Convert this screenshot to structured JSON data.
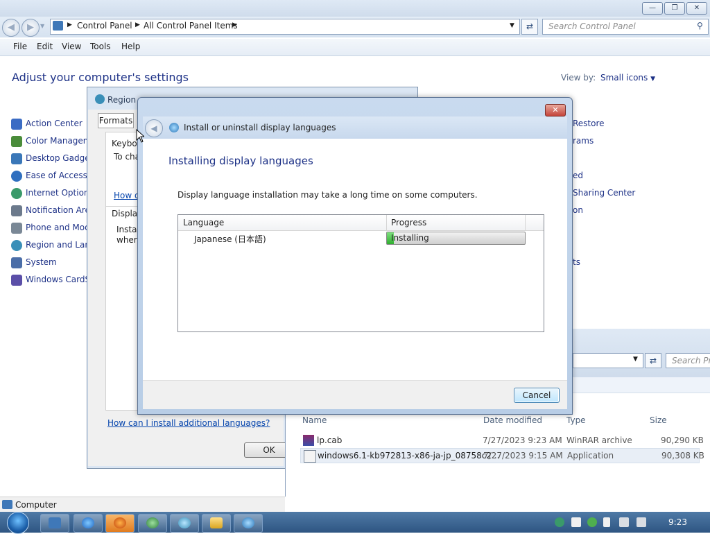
{
  "control_panel": {
    "breadcrumb": [
      "Control Panel",
      "All Control Panel Items"
    ],
    "search_placeholder": "Search Control Panel",
    "menu": [
      "File",
      "Edit",
      "View",
      "Tools",
      "Help"
    ],
    "page_title": "Adjust your computer's settings",
    "view_by_label": "View by:",
    "view_by_value": "Small icons",
    "left_items": [
      "Action Center",
      "Color Manageme",
      "Desktop Gadgets",
      "Ease of Access C",
      "Internet Options",
      "Notification Area",
      "Phone and Mode",
      "Region and Lang",
      "System",
      "Windows CardSp"
    ],
    "right_items": [
      "Restore",
      "rams",
      "ed",
      "Sharing Center",
      "on",
      "ts"
    ],
    "status_text": "Computer"
  },
  "region_dialog": {
    "title": "Region a",
    "tab_formats": "Formats",
    "keyboard_heading": "Keyboa",
    "keyboard_text": "To cha",
    "keyboard_link": "How d",
    "display_heading": "Display",
    "display_text_1": "Install",
    "display_text_2": "where",
    "install_link": "How can I install additional languages?",
    "ok_label": "OK"
  },
  "install_dialog": {
    "title": "Install or uninstall display languages",
    "heading": "Installing display languages",
    "description": "Display language installation may take a long time on some computers.",
    "columns": [
      "Language",
      "Progress"
    ],
    "rows": [
      {
        "language": "Japanese (日本語)",
        "status": "Installing",
        "progress": 0.05
      }
    ],
    "cancel_label": "Cancel",
    "close_glyph": "✕"
  },
  "explorer": {
    "search_placeholder": "Search Pro",
    "columns": [
      "Name",
      "Date modified",
      "Type",
      "Size"
    ],
    "files": [
      {
        "name": "lp.cab",
        "date": "7/27/2023 9:23 AM",
        "type": "WinRAR archive",
        "size": "90,290 KB"
      },
      {
        "name": "windows6.1-kb972813-x86-ja-jp_08758c2...",
        "date": "7/27/2023 9:15 AM",
        "type": "Application",
        "size": "90,308 KB"
      }
    ]
  },
  "taskbar": {
    "clock": "9:23",
    "buttons": [
      "control-panel",
      "internet-explorer",
      "firefox",
      "globe-app",
      "network-app",
      "folder",
      "language-app"
    ]
  },
  "colors": {
    "link_blue": "#1e3287",
    "progress_green": "#2fae2f",
    "taskbar": "#3d6896"
  }
}
